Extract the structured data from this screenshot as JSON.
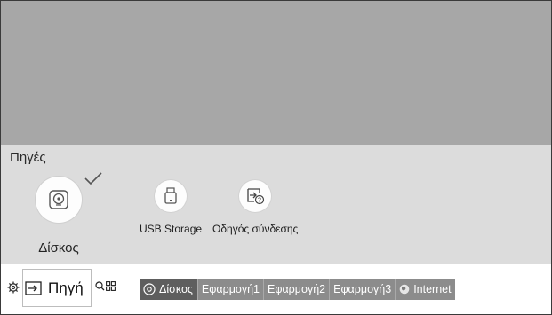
{
  "sources_panel": {
    "title": "Πηγές",
    "items": [
      {
        "label": "Δίσκος",
        "icon": "disc-icon",
        "selected": true
      },
      {
        "label": "USB Storage",
        "icon": "usb-icon"
      },
      {
        "label": "Οδηγός σύνδεσης",
        "icon": "connection-guide-icon"
      }
    ]
  },
  "bottom_bar": {
    "source_label": "Πηγή",
    "apps": [
      {
        "label": "Δίσκος",
        "icon": "disc-icon",
        "selected": true
      },
      {
        "label": "Εφαρμογή1"
      },
      {
        "label": "Εφαρμογή2"
      },
      {
        "label": "Εφαρμογή3"
      },
      {
        "label": "Internet",
        "icon": "globe-icon"
      }
    ]
  },
  "colors": {
    "top_area": "#a7a7a7",
    "panel": "#dcdcdc",
    "app_selected": "#5e5e5e",
    "app_normal": "#8c8c8c"
  }
}
